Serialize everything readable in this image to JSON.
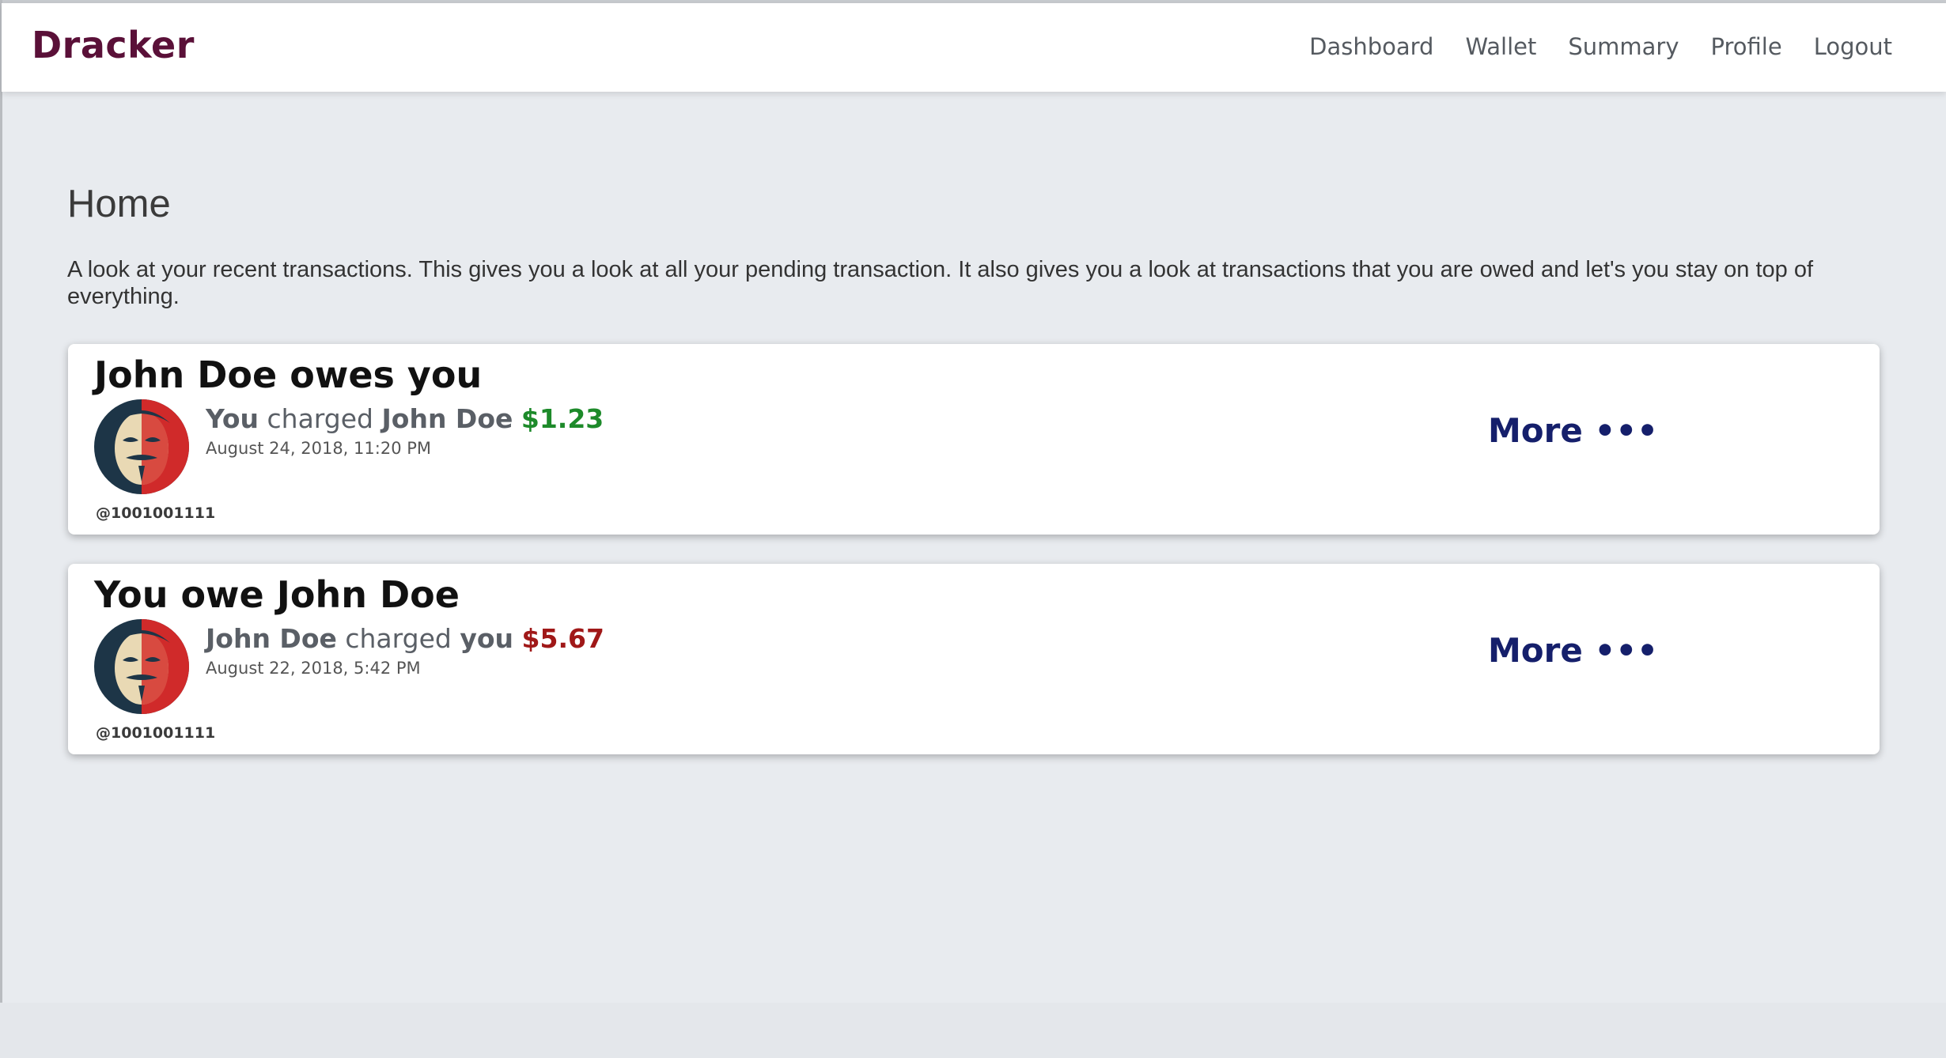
{
  "brand": "Dracker",
  "nav": {
    "items": [
      "Dashboard",
      "Wallet",
      "Summary",
      "Profile",
      "Logout"
    ]
  },
  "page": {
    "title": "Home",
    "description": "A look at your recent transactions. This gives you a look at all your pending transaction. It also gives you a look at transactions that you are owed and let's you stay on top of everything."
  },
  "cards": [
    {
      "title": "John Doe owes you",
      "actor": "You",
      "verb": "charged",
      "target": "John Doe",
      "amount": "$1.23",
      "amount_color": "#1d8a2a",
      "date": "August 24, 2018, 11:20 PM",
      "handle": "@1001001111",
      "more_label": "More •••"
    },
    {
      "title": "You owe John Doe",
      "actor": "John Doe",
      "verb": "charged",
      "target": "you",
      "amount": "$5.67",
      "amount_color": "#a01818",
      "date": "August 22, 2018, 5:42 PM",
      "handle": "@1001001111",
      "more_label": "More •••"
    }
  ]
}
